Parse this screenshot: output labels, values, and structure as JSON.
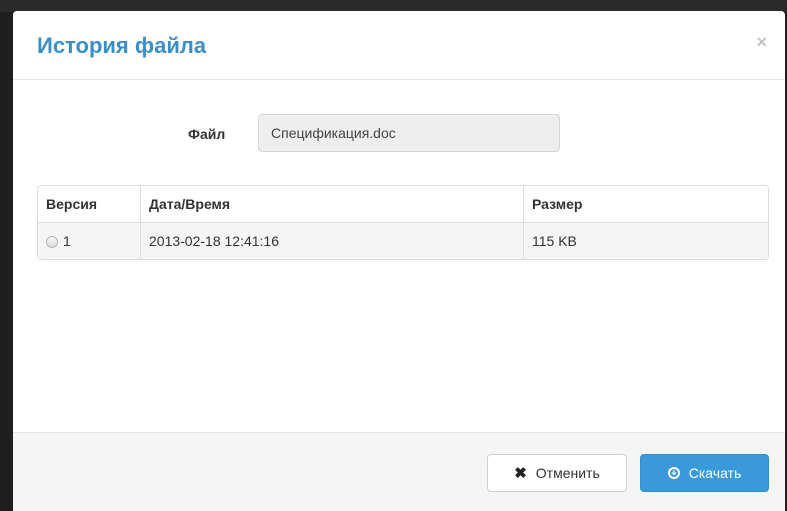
{
  "dialog": {
    "title": "История файла",
    "close_icon": "×"
  },
  "file": {
    "label": "Файл",
    "value": "Спецификация.doc"
  },
  "table": {
    "headers": [
      "Версия",
      "Дата/Время",
      "Размер"
    ],
    "rows": [
      {
        "version": "1",
        "datetime": "2013-02-18 12:41:16",
        "size": "115 KB",
        "selected": false
      }
    ]
  },
  "footer": {
    "cancel_label": "Отменить",
    "cancel_icon": "close-icon",
    "download_label": "Скачать",
    "download_icon": "download-icon"
  },
  "colors": {
    "title": "#3a8fc8",
    "primary_button": "#3a9ad9"
  }
}
